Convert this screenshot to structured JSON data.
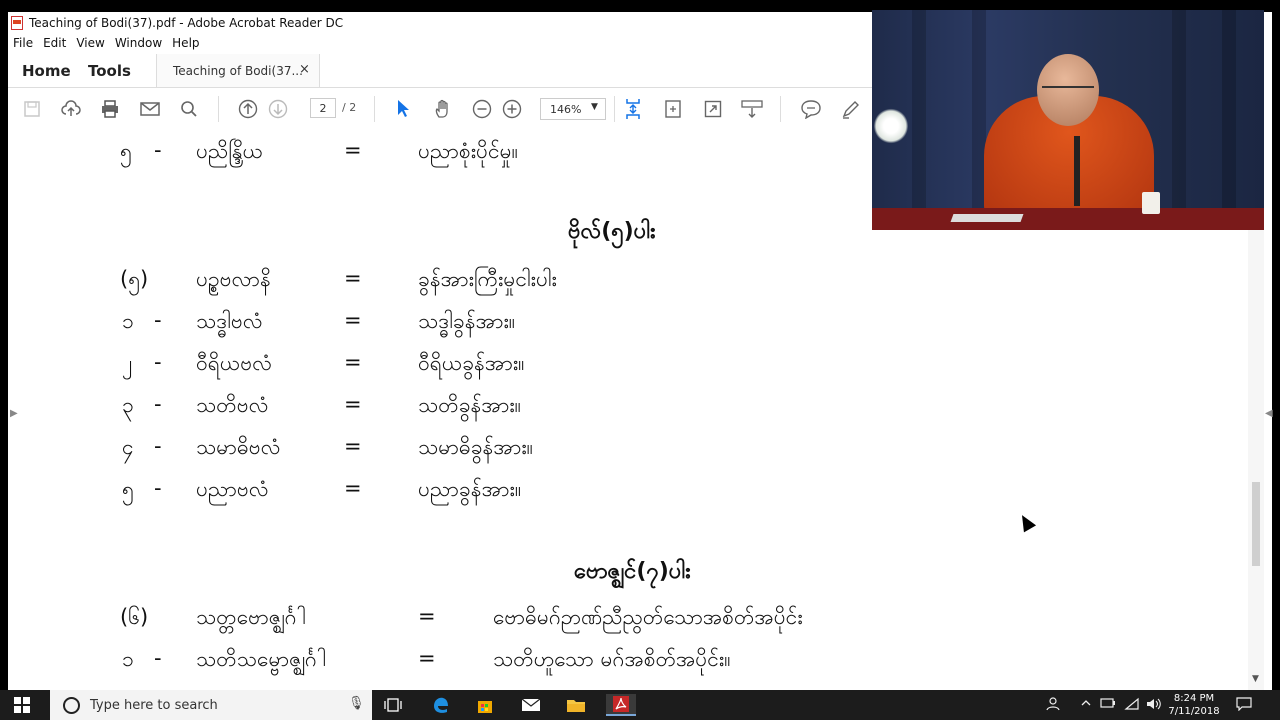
{
  "window": {
    "title": "Teaching of Bodi(37).pdf - Adobe Acrobat Reader DC"
  },
  "menu": [
    "File",
    "Edit",
    "View",
    "Window",
    "Help"
  ],
  "tabs": {
    "home": "Home",
    "tools": "Tools",
    "document": "Teaching of Bodi(37...",
    "close": "×"
  },
  "toolbar": {
    "page_current": "2",
    "page_total": "/ 2",
    "zoom": "146%"
  },
  "document": {
    "top_line": {
      "num": "၅",
      "dash": "-",
      "term": "ပညိန္ဒြိယ",
      "eq": "=",
      "meaning": "ပညာစုံးပိုင်မှု။"
    },
    "section1": {
      "heading": "ဗိုလ်(၅)ပါး",
      "intro": {
        "num": "(၅)",
        "term": "ပဥ္စဗလာနိ",
        "eq": "=",
        "meaning": "ခွန်အားကြီးမှုငါးပါး"
      },
      "items": [
        {
          "num": "၁",
          "dash": "-",
          "term": "သဒ္ဓါဗလံ",
          "eq": "=",
          "meaning": "သဒ္ဓါခွန်အား။"
        },
        {
          "num": "၂",
          "dash": "-",
          "term": "ဝီရိယဗလံ",
          "eq": "=",
          "meaning": "ဝီရိယခွန်အား။"
        },
        {
          "num": "၃",
          "dash": "-",
          "term": "သတိဗလံ",
          "eq": "=",
          "meaning": "သတိခွန်အား။"
        },
        {
          "num": "၄",
          "dash": "-",
          "term": "သမာဓိဗလံ",
          "eq": "=",
          "meaning": "သမာဓိခွန်အား။"
        },
        {
          "num": "၅",
          "dash": "-",
          "term": "ပညာဗလံ",
          "eq": "=",
          "meaning": "ပညာခွန်အား။"
        }
      ]
    },
    "section2": {
      "heading": "ဗောဇ္ဈင်(၇)ပါး",
      "intro": {
        "num": "(၆)",
        "term": "သတ္တဗောဇ္ဈင်္ဂါ",
        "eq": "=",
        "meaning": "ဗောဓိမဂ်ဉာဏ်ညီညွတ်သောအစိတ်အပိုင်း"
      },
      "items": [
        {
          "num": "၁",
          "dash": "-",
          "term": "သတိသမ္ဗောဇ္ဈင်္ဂါ",
          "eq": "=",
          "meaning": "သတိဟူသော မဂ်အစိတ်အပိုင်း။"
        }
      ]
    }
  },
  "taskbar": {
    "search_placeholder": "Type here to search",
    "time": "8:24 PM",
    "date": "7/11/2018"
  },
  "colors": {
    "taskbar": "#1c1c1c",
    "active_tool": "#1473e6",
    "robe": "#d2491a"
  }
}
